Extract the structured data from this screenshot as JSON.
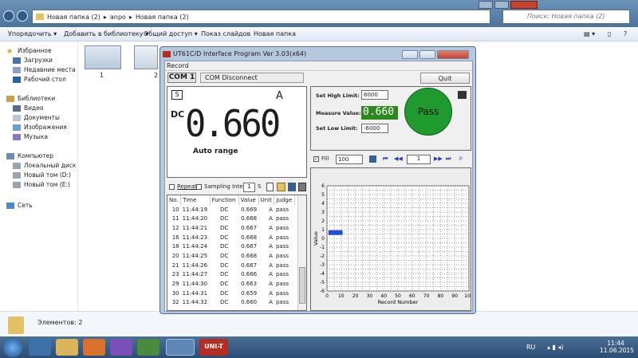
{
  "explorer": {
    "breadcrumb": [
      "Новая папка (2)",
      "anpo",
      "Новая папка (2)"
    ],
    "search_placeholder": "Поиск: Новая папка (2)",
    "toolbar": [
      "Упорядочить ▾",
      "Добавить в библиотеку ▾",
      "Общий доступ ▾",
      "Показ слайдов",
      "Новая папка"
    ],
    "nav": [
      "Избранное",
      "Загрузки",
      "Недавние места",
      "Рабочий стол",
      "Библиотеки",
      "Видео",
      "Документы",
      "Изображения",
      "Музыка",
      "Компьютер",
      "Локальный диск (C",
      "Новый том (D:)",
      "Новый том (E:)",
      "Сеть"
    ],
    "thumbs": [
      "1",
      "2"
    ],
    "status": "Элементов: 2"
  },
  "app": {
    "title": "UT61C/D Interface Program Ver 3.03(x64)",
    "menu": "Record",
    "com": "COM 1",
    "com_status": "COM Disconnect",
    "quit": "Quit",
    "mode_box": "S",
    "unit": "A",
    "func": "DC",
    "reading": "0.660",
    "range": "Auto range",
    "high_label": "Set High Limit:",
    "high_value": "6000",
    "measure_label": "Measure Value:",
    "measure_value": "0.660",
    "low_label": "Set Low Limit:",
    "low_value": "-6000",
    "pass": "Pass",
    "fill_label": "Fill",
    "fill_value": "100",
    "page": "1",
    "repeat": "Repeat",
    "sampling": "Sampling Interval",
    "sampling_value": "1",
    "sampling_unit": "S",
    "table": {
      "headers": [
        "No.",
        "Time",
        "Function",
        "Value",
        "Unit",
        "Judge"
      ],
      "rows": [
        [
          "10",
          "11:44:19",
          "DC",
          "0.669",
          "A",
          "pass"
        ],
        [
          "11",
          "11:44:20",
          "DC",
          "0.668",
          "A",
          "pass"
        ],
        [
          "12",
          "11:44:21",
          "DC",
          "0.667",
          "A",
          "pass"
        ],
        [
          "16",
          "11:44:23",
          "DC",
          "0.668",
          "A",
          "pass"
        ],
        [
          "18",
          "11:44:24",
          "DC",
          "0.667",
          "A",
          "pass"
        ],
        [
          "20",
          "11:44:25",
          "DC",
          "0.668",
          "A",
          "pass"
        ],
        [
          "21",
          "11:44:26",
          "DC",
          "0.667",
          "A",
          "pass"
        ],
        [
          "23",
          "11:44:27",
          "DC",
          "0.666",
          "A",
          "pass"
        ],
        [
          "29",
          "11:44:30",
          "DC",
          "0.663",
          "A",
          "pass"
        ],
        [
          "30",
          "11:44:31",
          "DC",
          "0.659",
          "A",
          "pass"
        ],
        [
          "32",
          "11:44:32",
          "DC",
          "0.660",
          "A",
          "pass"
        ]
      ]
    },
    "chart_data": {
      "type": "line",
      "xlabel": "Record Number",
      "ylabel": "Value",
      "xlim": [
        0,
        100
      ],
      "ylim": [
        -6,
        6
      ],
      "xticks": [
        "0",
        "10",
        "20",
        "30",
        "40",
        "50",
        "60",
        "70",
        "80",
        "90",
        "100"
      ],
      "yticks": [
        "6",
        "5",
        "4",
        "3",
        "2",
        "1",
        "0",
        "-1",
        "-2",
        "-3",
        "-4",
        "-5",
        "-6"
      ],
      "series": [
        {
          "x_range": [
            1,
            11
          ],
          "value": 0.66
        }
      ],
      "grid": true
    }
  },
  "taskbar": {
    "lang": "RU",
    "time": "11:44",
    "date": "11.06.2015",
    "app_label": "UNI-T"
  },
  "colors": {
    "pass_green": "#1f9a2e",
    "measure_green": "#2a8a1e",
    "bar_blue": "#1d4fd8",
    "grid": "#9a9a9a"
  }
}
